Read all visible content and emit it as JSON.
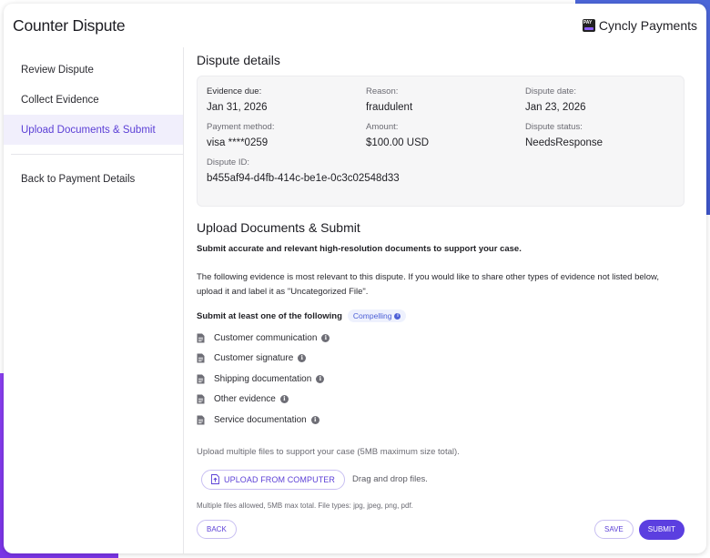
{
  "header": {
    "title": "Counter Dispute",
    "brand_name": "Cyncly Payments",
    "brand_logo_text": "PAY"
  },
  "sidebar": {
    "items": [
      {
        "label": "Review Dispute"
      },
      {
        "label": "Collect Evidence"
      },
      {
        "label": "Upload Documents & Submit"
      }
    ],
    "back_label": "Back to Payment Details"
  },
  "details": {
    "section_title": "Dispute details",
    "evidence_due_label": "Evidence due:",
    "evidence_due": "Jan 31, 2026",
    "reason_label": "Reason:",
    "reason": "fraudulent",
    "dispute_date_label": "Dispute date:",
    "dispute_date": "Jan 23, 2026",
    "payment_method_label": "Payment method:",
    "payment_method": "visa ****0259",
    "amount_label": "Amount:",
    "amount": "$100.00 USD",
    "status_label": "Dispute status:",
    "status": "NeedsResponse",
    "dispute_id_label": "Dispute ID:",
    "dispute_id": "b455af94-d4fb-414c-be1e-0c3c02548d33"
  },
  "upload": {
    "title": "Upload Documents & Submit",
    "lead": "Submit accurate and relevant high-resolution documents to support your case.",
    "description": "The following evidence is most relevant to this dispute. If you would like to share other types of evidence not listed below, upload it and label it as \"Uncategorized File\".",
    "requirement": "Submit at least one of the following",
    "chip_label": "Compelling",
    "evidence_items": [
      {
        "label": "Customer communication"
      },
      {
        "label": "Customer signature"
      },
      {
        "label": "Shipping documentation"
      },
      {
        "label": "Other evidence"
      },
      {
        "label": "Service documentation"
      }
    ],
    "upload_note": "Upload multiple files to support your case (5MB maximum size total).",
    "upload_button": "UPLOAD FROM COMPUTER",
    "drag_text": "Drag and drop files.",
    "fine_print": "Multiple files allowed, 5MB max total. File types: jpg, jpeg, png, pdf."
  },
  "footer": {
    "back_label": "BACK",
    "save_label": "SAVE",
    "submit_label": "SUBMIT"
  },
  "colors": {
    "accent": "#5b3fe0",
    "active_nav_bg": "#f1effc",
    "chip_text": "#4c5fd6",
    "bg_purple": "#8a3ff0",
    "bg_blue": "#4c66d8"
  },
  "icons": {
    "evidence_item": "document-icon",
    "info": "info-icon",
    "upload": "file-upload-icon"
  }
}
